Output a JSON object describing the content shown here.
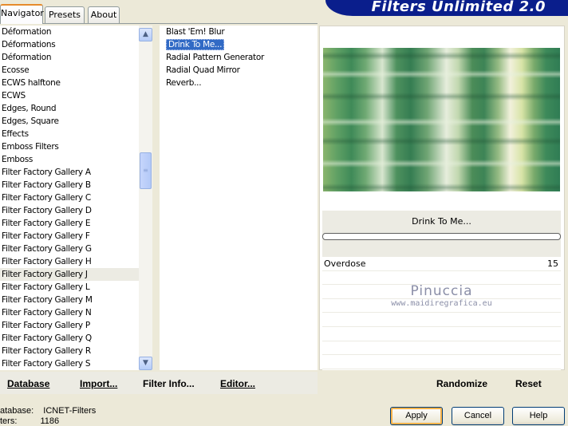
{
  "tabs": [
    {
      "label": "Navigator",
      "active": true
    },
    {
      "label": "Presets",
      "active": false
    },
    {
      "label": "About",
      "active": false
    }
  ],
  "banner": {
    "title": "Filters Unlimited 2.0"
  },
  "categories": {
    "items": [
      "Déformation",
      "Déformations",
      "Déformation",
      "Ecosse",
      "ECWS halftone",
      "ECWS",
      "Edges, Round",
      "Edges, Square",
      "Effects",
      "Emboss Filters",
      "Emboss",
      "Filter Factory Gallery A",
      "Filter Factory Gallery B",
      "Filter Factory Gallery C",
      "Filter Factory Gallery D",
      "Filter Factory Gallery E",
      "Filter Factory Gallery F",
      "Filter Factory Gallery G",
      "Filter Factory Gallery H",
      "Filter Factory Gallery J",
      "Filter Factory Gallery L",
      "Filter Factory Gallery M",
      "Filter Factory Gallery N",
      "Filter Factory Gallery P",
      "Filter Factory Gallery Q",
      "Filter Factory Gallery R",
      "Filter Factory Gallery S"
    ],
    "selected": "Filter Factory Gallery J"
  },
  "filters": {
    "items": [
      "Blast 'Em! Blur",
      "Drink To Me...",
      "Radial Pattern Generator",
      "Radial Quad Mirror",
      "Reverb..."
    ],
    "selected": "Drink To Me..."
  },
  "preview": {
    "filter_name": "Drink To Me..."
  },
  "parameters": [
    {
      "label": "Overdose",
      "value": "15"
    }
  ],
  "watermark": {
    "name": "Pinuccia",
    "url": "www.maidiregrafica.eu"
  },
  "actions": {
    "database": "Database",
    "import": "Import...",
    "filter_info": "Filter Info...",
    "editor": "Editor...",
    "randomize": "Randomize",
    "reset": "Reset"
  },
  "status": {
    "database_label": "atabase:",
    "database_value": "ICNET-Filters",
    "filters_label": "ters:",
    "filters_value": "1186"
  },
  "buttons": {
    "apply": "Apply",
    "cancel": "Cancel",
    "help": "Help"
  },
  "colors": {
    "banner": "#0a1e8c",
    "selection": "#316ac5",
    "default_button_ring": "#f8b34a"
  }
}
